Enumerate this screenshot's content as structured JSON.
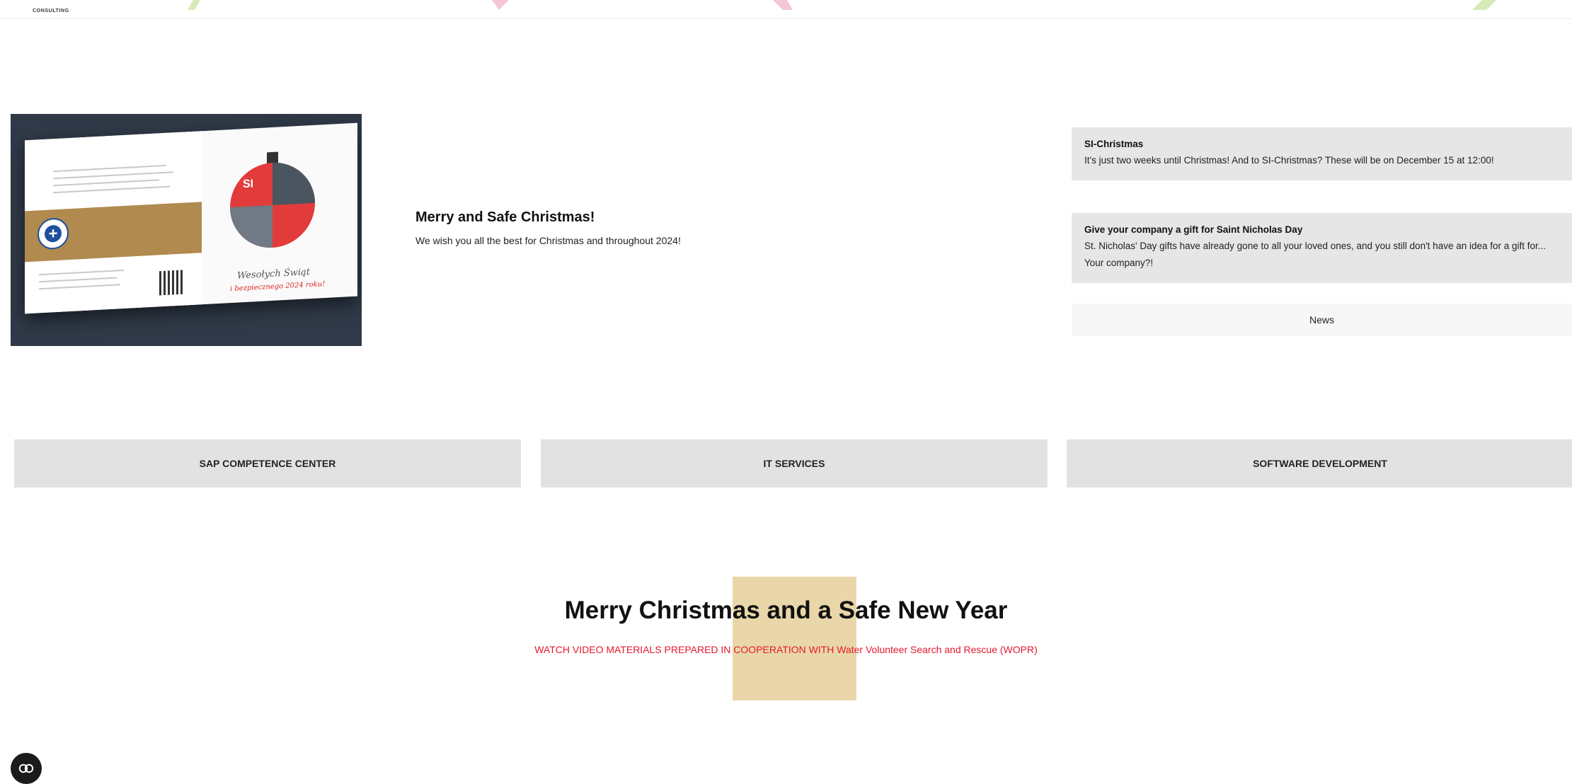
{
  "header": {
    "logo_text": "CONSULTING",
    "decor_colors": [
      "#d7e9b8",
      "#f3c6d6",
      "#f3c6d6",
      "#d7e9b8"
    ]
  },
  "featured_post": {
    "image_label": "Christmas card - Wesołych Świąt i bezpiecznego 2024 roku!",
    "card_text_1": "Wesołych Świąt",
    "card_text_2": "i bezpiecznego 2024 roku!",
    "ornament_logo": "SI",
    "title": "Merry and Safe Christmas!",
    "text": "We wish you all the best for Christmas and throughout 2024!"
  },
  "news": {
    "items": [
      {
        "title": "SI-Christmas",
        "text": "It's just two weeks until Christmas! And to SI-Christmas? These will be on December 15 at 12:00!"
      },
      {
        "title": "Give your company a gift for Saint Nicholas Day",
        "text": "St. Nicholas' Day gifts have already gone to all your loved ones, and you still don't have an idea for a gift for... Your company?!"
      }
    ],
    "link_label": "News"
  },
  "services": [
    {
      "label": "SAP COMPETENCE CENTER"
    },
    {
      "label": "IT SERVICES"
    },
    {
      "label": "SOFTWARE DEVELOPMENT"
    }
  ],
  "video_section": {
    "title": "Merry Christmas and a Safe New Year",
    "subtitle": "WATCH VIDEO MATERIALS PREPARED IN COOPERATION WITH Water Volunteer Search and Rescue (WOPR)",
    "subtitle_color": "#e3182d",
    "highlight_color": "#ead7a9"
  },
  "cookie_button": {
    "icon": "cookie-settings-icon"
  }
}
